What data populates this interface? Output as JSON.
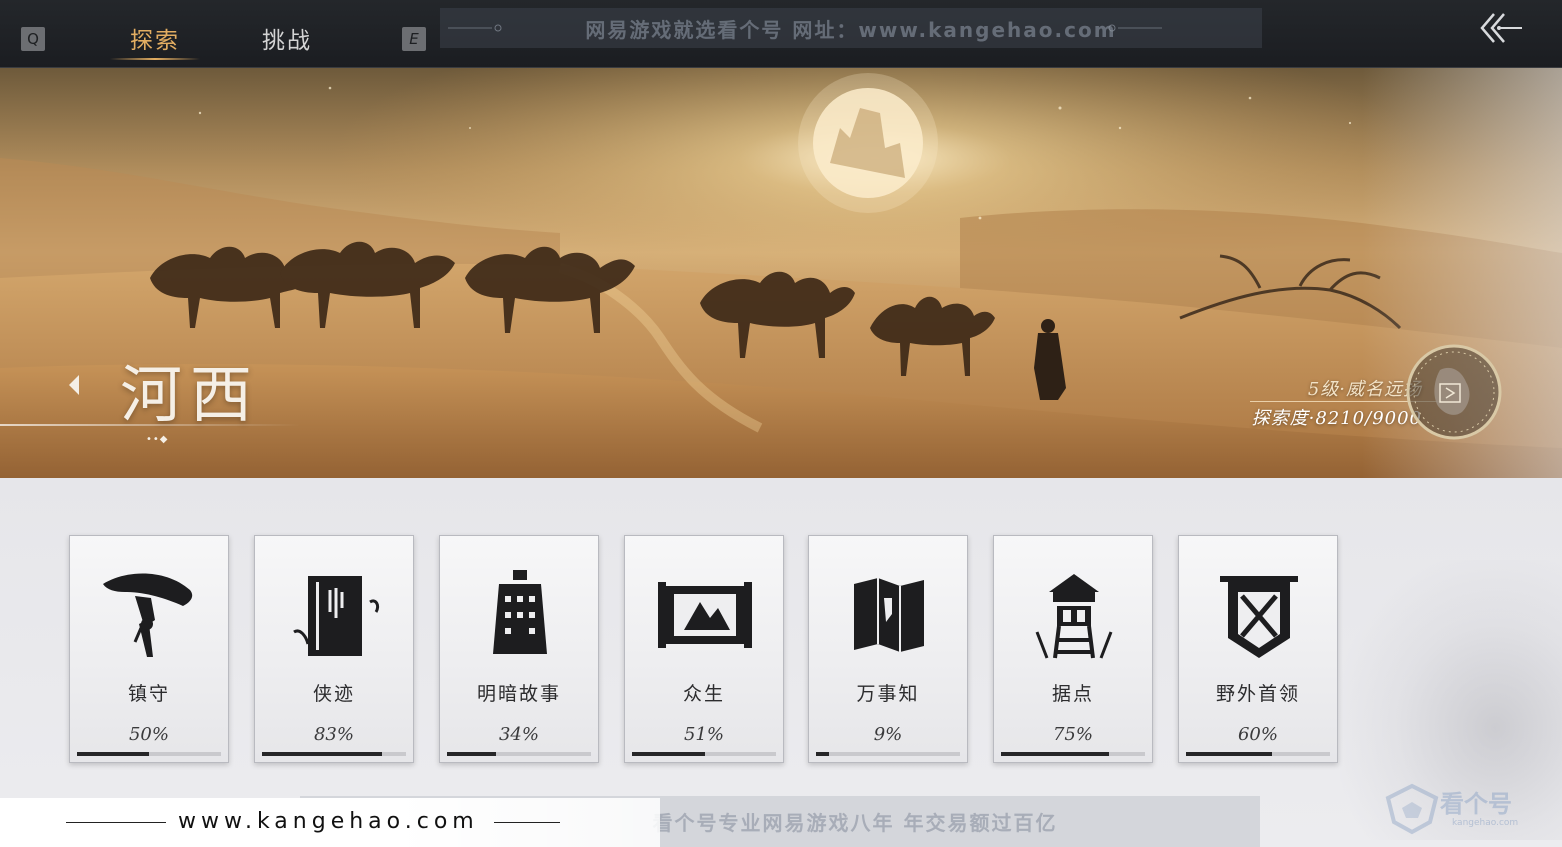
{
  "topbar": {
    "key_left": "Q",
    "key_right": "E",
    "tabs": [
      {
        "label": "探索",
        "active": true
      },
      {
        "label": "挑战",
        "active": false
      }
    ],
    "watermark": "网易游戏就选看个号   网址：www.kangehao.com",
    "back_icon": "double-chevron-left-icon"
  },
  "region": {
    "name": "河西",
    "dots": "••◆",
    "rank": "5级·威名远扬",
    "progress": "探索度·8210/9000"
  },
  "categories": [
    {
      "name": "镇守",
      "percent": "50%",
      "fill": 0.5,
      "icon": "bamboo-hat-icon"
    },
    {
      "name": "侠迹",
      "percent": "83%",
      "fill": 0.83,
      "icon": "bamboo-scroll-icon"
    },
    {
      "name": "明暗故事",
      "percent": "34%",
      "fill": 0.34,
      "icon": "bell-icon"
    },
    {
      "name": "众生",
      "percent": "51%",
      "fill": 0.51,
      "icon": "painting-scroll-icon"
    },
    {
      "name": "万事知",
      "percent": "9%",
      "fill": 0.09,
      "icon": "folded-map-icon"
    },
    {
      "name": "据点",
      "percent": "75%",
      "fill": 0.75,
      "icon": "watchtower-icon"
    },
    {
      "name": "野外首领",
      "percent": "60%",
      "fill": 0.6,
      "icon": "crossed-swords-banner-icon"
    }
  ],
  "footer": {
    "url": "www.kangehao.com",
    "banner": "看个号专业网易游戏八年   年交易额过百亿",
    "logo_text": "看个号",
    "logo_sub": "kangehao.com"
  },
  "colors": {
    "accent": "#e3ae62",
    "topbar": "#1e2024",
    "bar_fill": "#262628"
  }
}
